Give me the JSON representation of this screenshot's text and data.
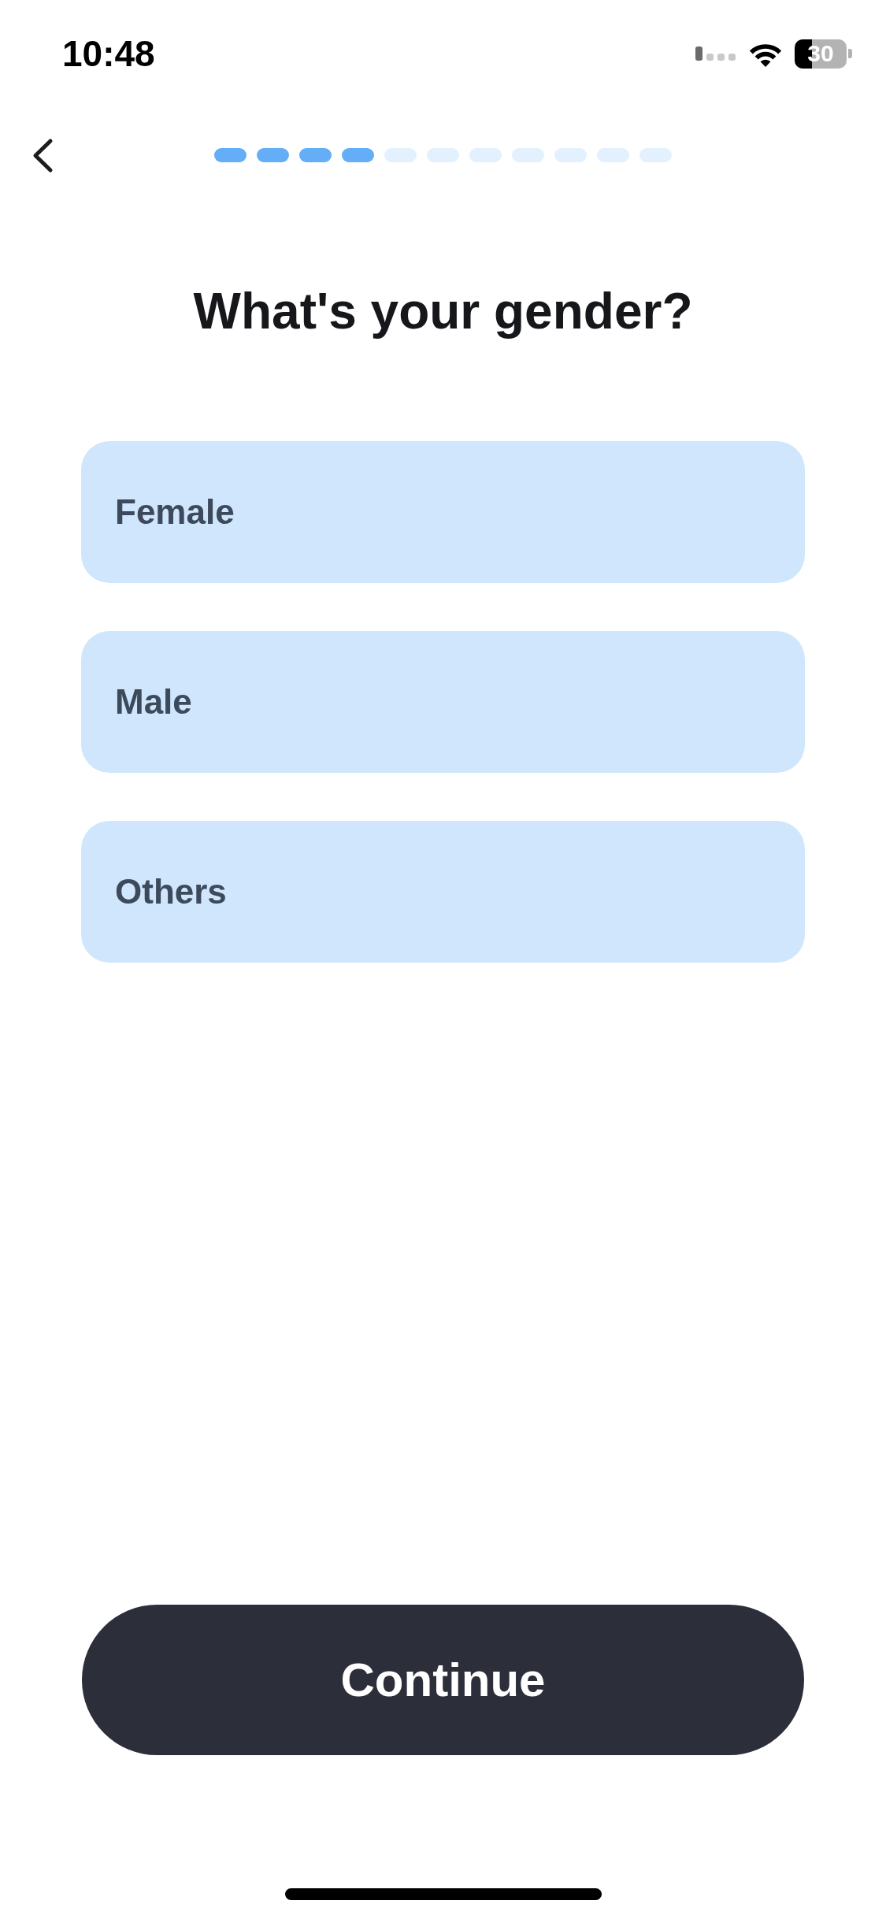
{
  "status_bar": {
    "time": "10:48",
    "battery": "30"
  },
  "header": {
    "progress_steps": [
      {
        "done": true
      },
      {
        "done": true
      },
      {
        "done": true
      },
      {
        "done": true
      },
      {
        "done": false
      },
      {
        "done": false
      },
      {
        "done": false
      },
      {
        "done": false
      },
      {
        "done": false
      },
      {
        "done": false
      },
      {
        "done": false
      }
    ]
  },
  "title": "What's your gender?",
  "options": [
    {
      "label": "Female",
      "selected": false
    },
    {
      "label": "Male",
      "selected": false
    },
    {
      "label": "Others",
      "selected": false
    }
  ],
  "continue_button": {
    "label": "Continue"
  }
}
